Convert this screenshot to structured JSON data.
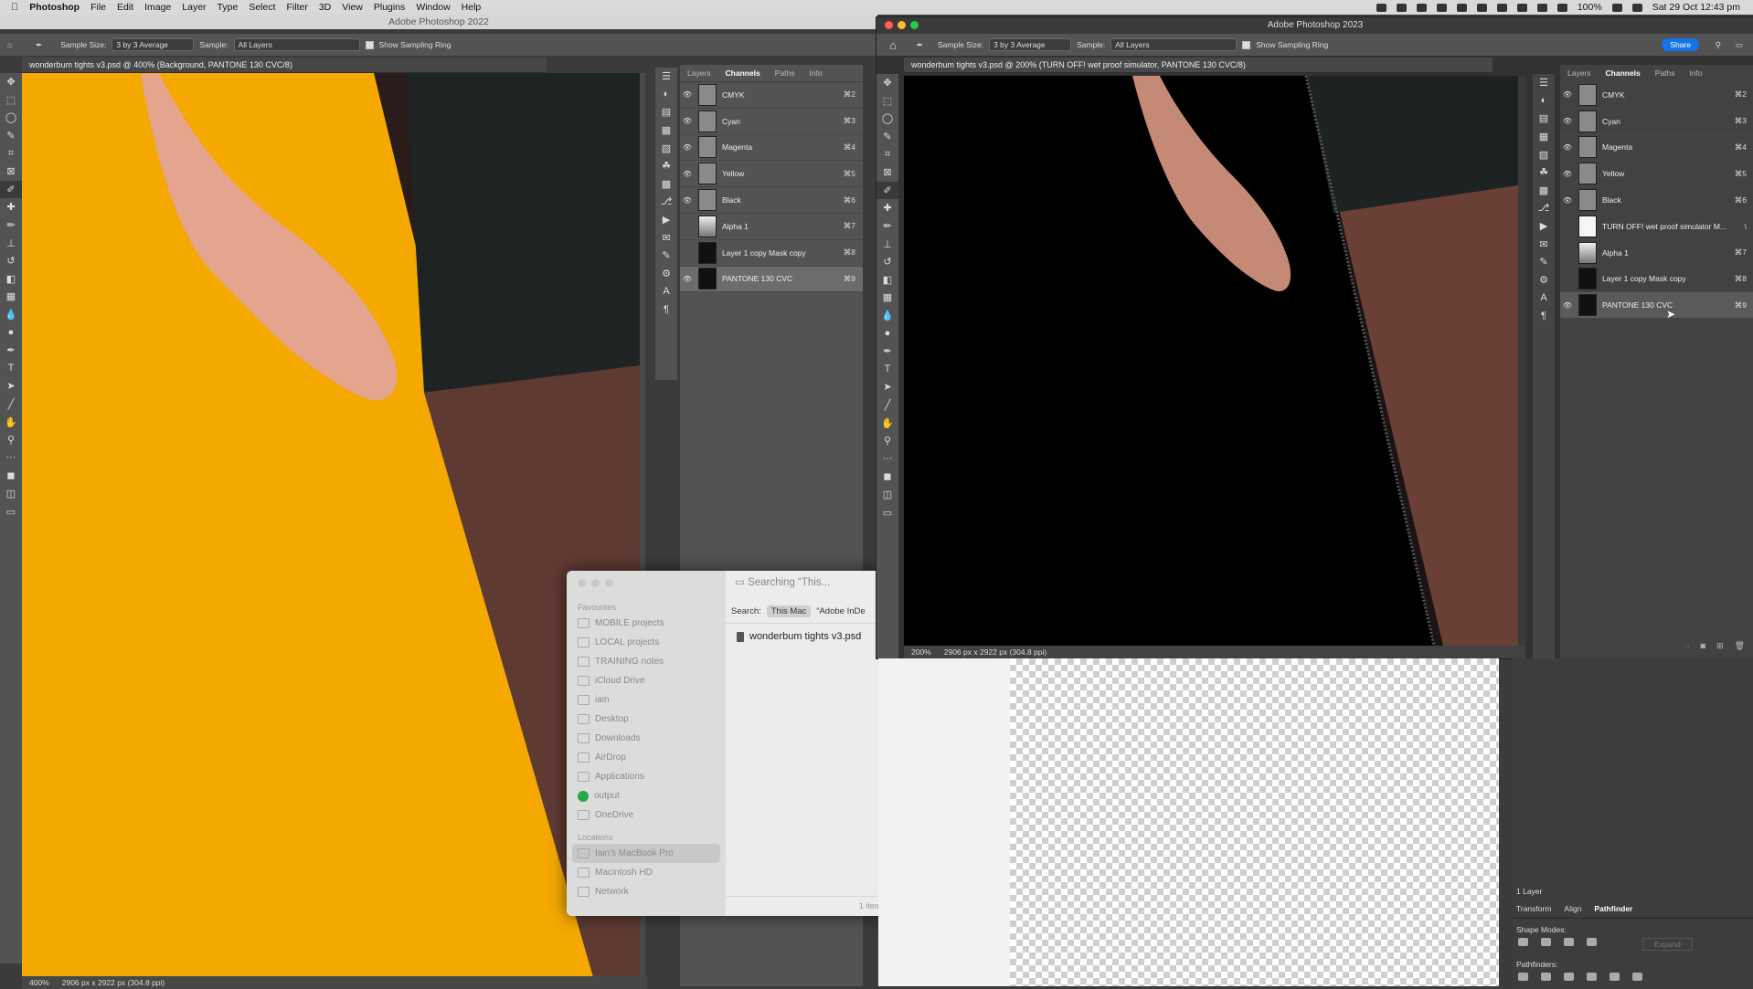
{
  "menubar": {
    "app": "Photoshop",
    "items": [
      "File",
      "Edit",
      "Image",
      "Layer",
      "Type",
      "Select",
      "Filter",
      "3D",
      "View",
      "Plugins",
      "Window",
      "Help"
    ],
    "battery": "100%",
    "datetime": "Sat 29 Oct  12:43 pm"
  },
  "ps2022": {
    "title": "Adobe Photoshop 2022",
    "options": {
      "sample_size_label": "Sample Size:",
      "sample_size": "3 by 3 Average",
      "sample_label": "Sample:",
      "sample": "All Layers",
      "ring": "Show Sampling Ring"
    },
    "doc_tab": "wonderbum tights v3.psd @ 400% (Background, PANTONE 130 CVC/8)",
    "zoom": "400%",
    "doc_info": "2906 px x 2922 px (304.8 ppi)",
    "panel_tabs": [
      "Layers",
      "Channels",
      "Paths",
      "Info"
    ],
    "channels": [
      {
        "name": "CMYK",
        "kb": "⌘2",
        "eye": true
      },
      {
        "name": "Cyan",
        "kb": "⌘3",
        "eye": true
      },
      {
        "name": "Magenta",
        "kb": "⌘4",
        "eye": true
      },
      {
        "name": "Yellow",
        "kb": "⌘5",
        "eye": true
      },
      {
        "name": "Black",
        "kb": "⌘6",
        "eye": true
      },
      {
        "name": "Alpha 1",
        "kb": "⌘7",
        "eye": false
      },
      {
        "name": "Layer 1 copy Mask copy",
        "kb": "⌘8",
        "eye": false
      },
      {
        "name": "PANTONE 130 CVC",
        "kb": "⌘9",
        "eye": true
      }
    ]
  },
  "finder": {
    "title": "Searching “This...",
    "search_label": "Search:",
    "scope_this_mac": "This Mac",
    "scope_other": "“Adobe InDe",
    "result": "wonderbum tights v3.psd",
    "count": "1 item",
    "favourites_head": "Favourites",
    "favourites": [
      "MOBILE projects",
      "LOCAL projects",
      "TRAINING notes",
      "iCloud Drive",
      "iain",
      "Desktop",
      "Downloads",
      "AirDrop",
      "Applications",
      "output",
      "OneDrive"
    ],
    "locations_head": "Locations",
    "locations": [
      "Iain's MacBook Pro",
      "Macintosh HD",
      "Network"
    ]
  },
  "ps2023": {
    "title": "Adobe Photoshop 2023",
    "options": {
      "sample_size_label": "Sample Size:",
      "sample_size": "3 by 3 Average",
      "sample_label": "Sample:",
      "sample": "All Layers",
      "ring": "Show Sampling Ring"
    },
    "share": "Share",
    "doc_tab": "wonderbum tights v3.psd @ 200% (TURN OFF! wet proof simulator, PANTONE 130 CVC/8)",
    "zoom": "200%",
    "doc_info": "2906 px x 2922 px (304.8 ppi)",
    "panel_tabs": [
      "Layers",
      "Channels",
      "Paths",
      "Info"
    ],
    "channels": [
      {
        "name": "CMYK",
        "kb": "⌘2",
        "eye": true
      },
      {
        "name": "Cyan",
        "kb": "⌘3",
        "eye": true
      },
      {
        "name": "Magenta",
        "kb": "⌘4",
        "eye": true
      },
      {
        "name": "Yellow",
        "kb": "⌘5",
        "eye": true
      },
      {
        "name": "Black",
        "kb": "⌘6",
        "eye": true
      },
      {
        "name": "TURN OFF! wet proof simulator M...",
        "kb": "\\",
        "eye": false
      },
      {
        "name": "Alpha 1",
        "kb": "⌘7",
        "eye": false
      },
      {
        "name": "Layer 1 copy Mask copy",
        "kb": "⌘8",
        "eye": false
      },
      {
        "name": "PANTONE 130 CVC",
        "kb": "⌘9",
        "eye": true
      }
    ]
  },
  "bottom_panel": {
    "layers_count": "1 Layer",
    "tabs": [
      "Transform",
      "Align",
      "Pathfinder"
    ],
    "shape_modes": "Shape Modes:",
    "expand": "Expand",
    "pathfinders": "Pathfinders:"
  },
  "colors": {
    "pantone": "#f5a800",
    "ps_panel": "#535353",
    "accent": "#1473e6"
  }
}
